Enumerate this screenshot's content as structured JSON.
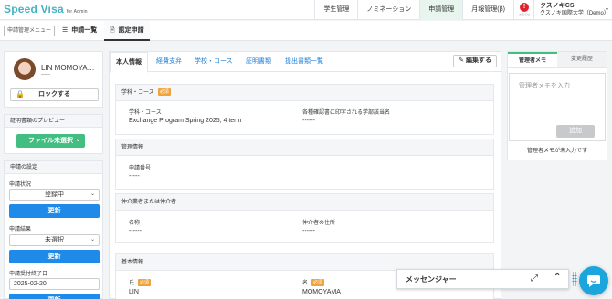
{
  "app": {
    "brand": "Speed Visa",
    "brand_sub": "for Admin"
  },
  "topnav": {
    "items": [
      "学生管理",
      "ノミネーション",
      "申請管理",
      "月報管理(β)"
    ],
    "alert_icon": "!",
    "alert_caption": "お知らせ",
    "user_name": "クスノキCS",
    "user_org": "クスノキ国際大学（Demo）"
  },
  "subbar": {
    "menu_button": "申請管理メニュー",
    "tab_list": "申請一覧",
    "tab_cert": "認定申請"
  },
  "profile": {
    "name": "LIN MOMOYA…",
    "sub": "-----",
    "lock_button": "ロックする"
  },
  "preview": {
    "title": "証明書類のプレビュー",
    "file_button": "ファイル未選択"
  },
  "settings": {
    "title": "申請の設定",
    "status_label": "申請状況",
    "status_value": "登録中",
    "update_label": "更新",
    "result_label": "申請結果",
    "result_value": "未選択",
    "deadline_label": "申請受付終了日",
    "deadline_value": "2025-02-20"
  },
  "main": {
    "tabs": [
      "本人情報",
      "経費支弁",
      "学校・コース",
      "証明書類",
      "提出書類一覧"
    ],
    "edit_button": "編集する",
    "required_badge": "必須",
    "course_section": {
      "title": "学科・コース",
      "field1_label": "学科・コース",
      "field1_value": "Exchange Program Spring 2025, 4 term",
      "field2_label": "各種確認書に印字される学部該当名",
      "field2_value": "------"
    },
    "manage_section": {
      "title": "管理情報",
      "field_label": "申請番号",
      "field_value": "-----"
    },
    "agent_section": {
      "title": "仲介業者または仲介者",
      "field1_label": "名称",
      "field1_value": "------",
      "field2_label": "仲介者の住所",
      "field2_value": "------"
    },
    "basic_section": {
      "title": "基本情報",
      "surname_label": "氏",
      "surname_value": "LIN",
      "given_label": "名",
      "given_value": "MOMOYAMA"
    }
  },
  "memo": {
    "tab_memo": "管理者メモ",
    "tab_history": "変更履歴",
    "placeholder": "管理者メモを入力",
    "add_button": "追加",
    "empty_text": "管理者メモが未入力です"
  },
  "messenger": {
    "title": "メッセンジャー"
  },
  "colors": {
    "brand": "#44b3c4",
    "green": "#43be82",
    "blue": "#1f8ae8",
    "required": "#f0a23b",
    "alert": "#e0232a",
    "chat": "#1aa5dd"
  }
}
